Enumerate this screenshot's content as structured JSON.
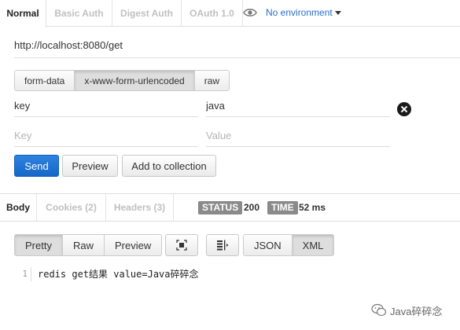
{
  "auth_tabs": [
    "Normal",
    "Basic Auth",
    "Digest Auth",
    "OAuth 1.0"
  ],
  "environment": {
    "label": "No environment"
  },
  "request": {
    "url": "http://localhost:8080/get"
  },
  "body_types": [
    "form-data",
    "x-www-form-urlencoded",
    "raw"
  ],
  "params": {
    "key": "key",
    "value": "java",
    "key_placeholder": "Key",
    "value_placeholder": "Value"
  },
  "actions": {
    "send": "Send",
    "preview": "Preview",
    "add_to_collection": "Add to collection"
  },
  "response_tabs": [
    "Body",
    "Cookies (2)",
    "Headers (3)"
  ],
  "status": {
    "label": "STATUS",
    "value": "200"
  },
  "time": {
    "label": "TIME",
    "value": "52 ms"
  },
  "view_modes": [
    "Pretty",
    "Raw",
    "Preview"
  ],
  "formats": [
    "JSON",
    "XML"
  ],
  "response_body": {
    "line_number": "1",
    "text": "redis get结果 value=Java碎碎念"
  },
  "watermark": {
    "text": "Java碎碎念"
  },
  "colors": {
    "primary": "#1566c8",
    "link": "#2a6fc9",
    "badge": "#8a8a8a"
  }
}
